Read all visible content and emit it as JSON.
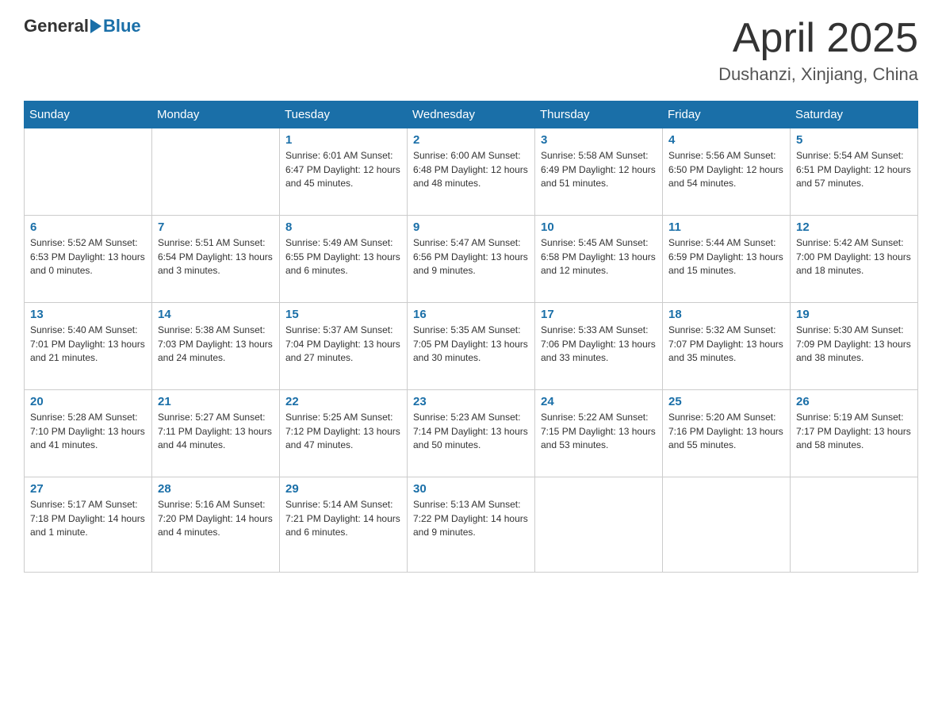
{
  "header": {
    "logo_text_general": "General",
    "logo_text_blue": "Blue",
    "month_year": "April 2025",
    "location": "Dushanzi, Xinjiang, China"
  },
  "days_of_week": [
    "Sunday",
    "Monday",
    "Tuesday",
    "Wednesday",
    "Thursday",
    "Friday",
    "Saturday"
  ],
  "weeks": [
    [
      {
        "day": "",
        "info": ""
      },
      {
        "day": "",
        "info": ""
      },
      {
        "day": "1",
        "info": "Sunrise: 6:01 AM\nSunset: 6:47 PM\nDaylight: 12 hours\nand 45 minutes."
      },
      {
        "day": "2",
        "info": "Sunrise: 6:00 AM\nSunset: 6:48 PM\nDaylight: 12 hours\nand 48 minutes."
      },
      {
        "day": "3",
        "info": "Sunrise: 5:58 AM\nSunset: 6:49 PM\nDaylight: 12 hours\nand 51 minutes."
      },
      {
        "day": "4",
        "info": "Sunrise: 5:56 AM\nSunset: 6:50 PM\nDaylight: 12 hours\nand 54 minutes."
      },
      {
        "day": "5",
        "info": "Sunrise: 5:54 AM\nSunset: 6:51 PM\nDaylight: 12 hours\nand 57 minutes."
      }
    ],
    [
      {
        "day": "6",
        "info": "Sunrise: 5:52 AM\nSunset: 6:53 PM\nDaylight: 13 hours\nand 0 minutes."
      },
      {
        "day": "7",
        "info": "Sunrise: 5:51 AM\nSunset: 6:54 PM\nDaylight: 13 hours\nand 3 minutes."
      },
      {
        "day": "8",
        "info": "Sunrise: 5:49 AM\nSunset: 6:55 PM\nDaylight: 13 hours\nand 6 minutes."
      },
      {
        "day": "9",
        "info": "Sunrise: 5:47 AM\nSunset: 6:56 PM\nDaylight: 13 hours\nand 9 minutes."
      },
      {
        "day": "10",
        "info": "Sunrise: 5:45 AM\nSunset: 6:58 PM\nDaylight: 13 hours\nand 12 minutes."
      },
      {
        "day": "11",
        "info": "Sunrise: 5:44 AM\nSunset: 6:59 PM\nDaylight: 13 hours\nand 15 minutes."
      },
      {
        "day": "12",
        "info": "Sunrise: 5:42 AM\nSunset: 7:00 PM\nDaylight: 13 hours\nand 18 minutes."
      }
    ],
    [
      {
        "day": "13",
        "info": "Sunrise: 5:40 AM\nSunset: 7:01 PM\nDaylight: 13 hours\nand 21 minutes."
      },
      {
        "day": "14",
        "info": "Sunrise: 5:38 AM\nSunset: 7:03 PM\nDaylight: 13 hours\nand 24 minutes."
      },
      {
        "day": "15",
        "info": "Sunrise: 5:37 AM\nSunset: 7:04 PM\nDaylight: 13 hours\nand 27 minutes."
      },
      {
        "day": "16",
        "info": "Sunrise: 5:35 AM\nSunset: 7:05 PM\nDaylight: 13 hours\nand 30 minutes."
      },
      {
        "day": "17",
        "info": "Sunrise: 5:33 AM\nSunset: 7:06 PM\nDaylight: 13 hours\nand 33 minutes."
      },
      {
        "day": "18",
        "info": "Sunrise: 5:32 AM\nSunset: 7:07 PM\nDaylight: 13 hours\nand 35 minutes."
      },
      {
        "day": "19",
        "info": "Sunrise: 5:30 AM\nSunset: 7:09 PM\nDaylight: 13 hours\nand 38 minutes."
      }
    ],
    [
      {
        "day": "20",
        "info": "Sunrise: 5:28 AM\nSunset: 7:10 PM\nDaylight: 13 hours\nand 41 minutes."
      },
      {
        "day": "21",
        "info": "Sunrise: 5:27 AM\nSunset: 7:11 PM\nDaylight: 13 hours\nand 44 minutes."
      },
      {
        "day": "22",
        "info": "Sunrise: 5:25 AM\nSunset: 7:12 PM\nDaylight: 13 hours\nand 47 minutes."
      },
      {
        "day": "23",
        "info": "Sunrise: 5:23 AM\nSunset: 7:14 PM\nDaylight: 13 hours\nand 50 minutes."
      },
      {
        "day": "24",
        "info": "Sunrise: 5:22 AM\nSunset: 7:15 PM\nDaylight: 13 hours\nand 53 minutes."
      },
      {
        "day": "25",
        "info": "Sunrise: 5:20 AM\nSunset: 7:16 PM\nDaylight: 13 hours\nand 55 minutes."
      },
      {
        "day": "26",
        "info": "Sunrise: 5:19 AM\nSunset: 7:17 PM\nDaylight: 13 hours\nand 58 minutes."
      }
    ],
    [
      {
        "day": "27",
        "info": "Sunrise: 5:17 AM\nSunset: 7:18 PM\nDaylight: 14 hours\nand 1 minute."
      },
      {
        "day": "28",
        "info": "Sunrise: 5:16 AM\nSunset: 7:20 PM\nDaylight: 14 hours\nand 4 minutes."
      },
      {
        "day": "29",
        "info": "Sunrise: 5:14 AM\nSunset: 7:21 PM\nDaylight: 14 hours\nand 6 minutes."
      },
      {
        "day": "30",
        "info": "Sunrise: 5:13 AM\nSunset: 7:22 PM\nDaylight: 14 hours\nand 9 minutes."
      },
      {
        "day": "",
        "info": ""
      },
      {
        "day": "",
        "info": ""
      },
      {
        "day": "",
        "info": ""
      }
    ]
  ]
}
